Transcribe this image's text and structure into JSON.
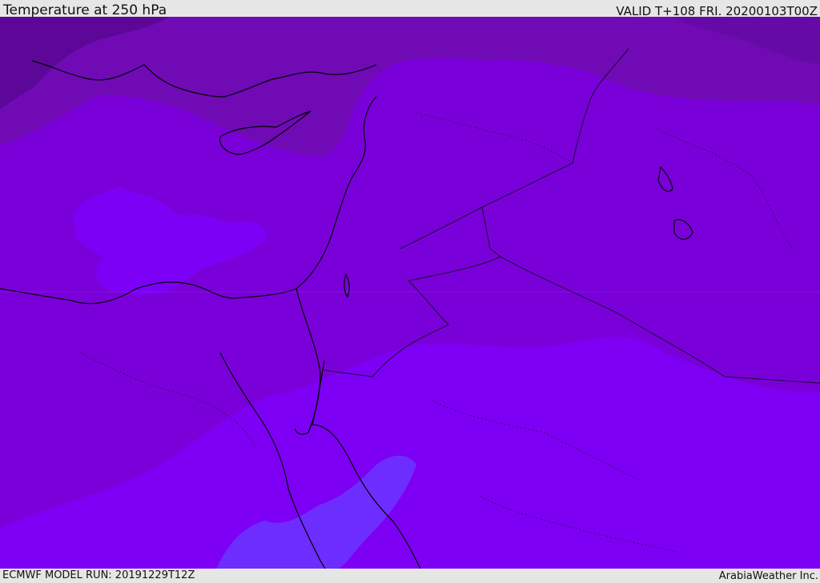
{
  "header": {
    "title": "Temperature at 250 hPa",
    "valid_time": "VALID T+108 FRI. 20200103T00Z"
  },
  "footer": {
    "model_run": "ECMWF MODEL RUN: 20191229T12Z",
    "credit": "ArabiaWeather Inc."
  },
  "map": {
    "field": "temperature-250hPa",
    "colors": {
      "band_coldest": "#5c0797",
      "band_cold": "#6f0ab5",
      "band_mid": "#7a08c8",
      "band_base": "#7c00dc",
      "band_warm": "#7d00f5",
      "band_warmest": "#6e2dff",
      "coastline": "#000000",
      "border": "#1a0a30"
    }
  }
}
